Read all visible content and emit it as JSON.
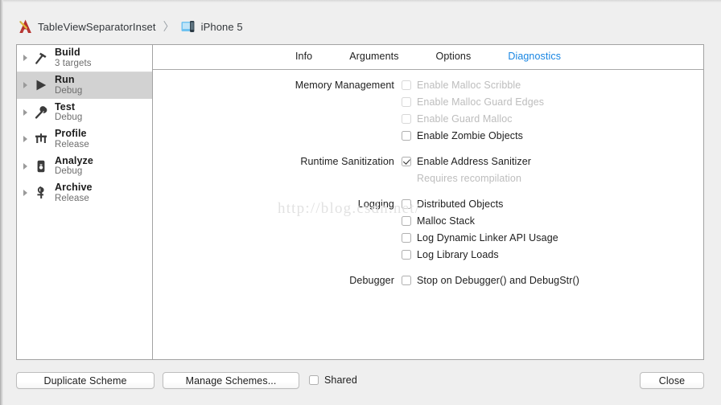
{
  "breadcrumb": {
    "scheme_icon": "xcode-scheme-icon",
    "scheme_name": "TableViewSeparatorInset",
    "separator": "〉",
    "device_icon": "iphone-simulator-icon",
    "device_name": "iPhone 5"
  },
  "sidebar": {
    "items": [
      {
        "title": "Build",
        "subtitle": "3 targets",
        "icon": "hammer-icon",
        "selected": false
      },
      {
        "title": "Run",
        "subtitle": "Debug",
        "icon": "play-icon",
        "selected": true
      },
      {
        "title": "Test",
        "subtitle": "Debug",
        "icon": "wrench-icon",
        "selected": false
      },
      {
        "title": "Profile",
        "subtitle": "Release",
        "icon": "gauge-icon",
        "selected": false
      },
      {
        "title": "Analyze",
        "subtitle": "Debug",
        "icon": "analyze-icon",
        "selected": false
      },
      {
        "title": "Archive",
        "subtitle": "Release",
        "icon": "archive-icon",
        "selected": false
      }
    ]
  },
  "tabs": [
    {
      "label": "Info",
      "active": false
    },
    {
      "label": "Arguments",
      "active": false
    },
    {
      "label": "Options",
      "active": false
    },
    {
      "label": "Diagnostics",
      "active": true
    }
  ],
  "diagnostics": {
    "memory_management": {
      "label": "Memory Management",
      "options": [
        {
          "label": "Enable Malloc Scribble",
          "checked": false,
          "disabled": true
        },
        {
          "label": "Enable Malloc Guard Edges",
          "checked": false,
          "disabled": true
        },
        {
          "label": "Enable Guard Malloc",
          "checked": false,
          "disabled": true
        },
        {
          "label": "Enable Zombie Objects",
          "checked": false,
          "disabled": false
        }
      ]
    },
    "runtime_sanitization": {
      "label": "Runtime Sanitization",
      "options": [
        {
          "label": "Enable Address Sanitizer",
          "checked": true,
          "disabled": false
        }
      ],
      "note": "Requires recompilation"
    },
    "logging": {
      "label": "Logging",
      "options": [
        {
          "label": "Distributed Objects",
          "checked": false,
          "disabled": false
        },
        {
          "label": "Malloc Stack",
          "checked": false,
          "disabled": false
        },
        {
          "label": "Log Dynamic Linker API Usage",
          "checked": false,
          "disabled": false
        },
        {
          "label": "Log Library Loads",
          "checked": false,
          "disabled": false
        }
      ]
    },
    "debugger": {
      "label": "Debugger",
      "options": [
        {
          "label": "Stop on Debugger() and DebugStr()",
          "checked": false,
          "disabled": false
        }
      ]
    }
  },
  "watermark": "http://blog.csdn.net/",
  "bottom_bar": {
    "duplicate_scheme": "Duplicate Scheme",
    "manage_schemes": "Manage Schemes...",
    "shared_label": "Shared",
    "shared_checked": false,
    "close": "Close"
  },
  "colors": {
    "accent": "#1785e2",
    "selected_row": "#d2d2d2",
    "panel_border": "#a2a2a2",
    "disabled_text": "#bdbdbd",
    "watermark": "#e2e2e2"
  }
}
